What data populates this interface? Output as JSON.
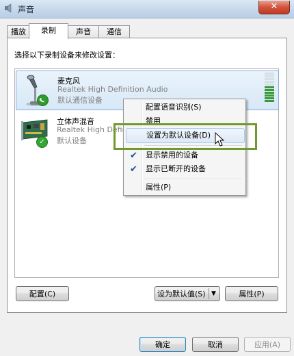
{
  "window": {
    "title": "声音",
    "close_glyph": "✕"
  },
  "tabs": [
    {
      "label": "播放",
      "active": false
    },
    {
      "label": "录制",
      "active": true
    },
    {
      "label": "声音",
      "active": false
    },
    {
      "label": "通信",
      "active": false
    }
  ],
  "instruction": "选择以下录制设备来修改设置：",
  "devices": [
    {
      "name": "麦克风",
      "driver": "Realtek High Definition Audio",
      "status": "默认通信设备",
      "icon": "microphone-icon",
      "badge": "phone-badge",
      "selected": true
    },
    {
      "name": "立体声混音",
      "driver": "Realtek High Definition Audio",
      "status": "默认设备",
      "icon": "sound-card-icon",
      "badge": "check-badge",
      "selected": false
    }
  ],
  "context_menu": {
    "items": [
      {
        "label": "配置语音识别(S)",
        "checked": false
      },
      {
        "label": "禁用",
        "checked": false
      },
      {
        "label": "设置为默认设备(D)",
        "checked": false,
        "hovered": true
      },
      {
        "label": "显示禁用的设备",
        "checked": true
      },
      {
        "label": "显示已断开的设备",
        "checked": true
      },
      {
        "label": "属性(P)",
        "checked": false
      }
    ]
  },
  "buttons": {
    "configure": "配置(C)",
    "set_default": "设为默认值(S)",
    "properties": "属性(P)",
    "ok": "确定",
    "cancel": "取消",
    "apply": "应用(A)"
  },
  "colors": {
    "highlight_border": "#6f9a2d",
    "selection": "#d7e8f7",
    "check": "#1a4fa0"
  }
}
